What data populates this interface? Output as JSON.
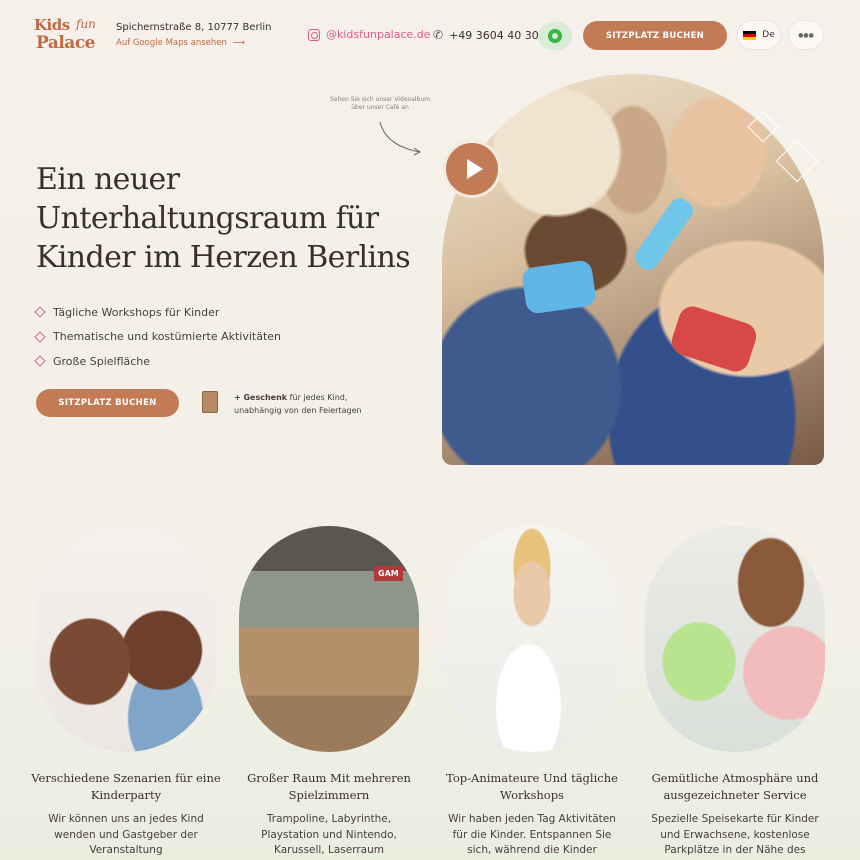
{
  "header": {
    "logo_line1": "Kids",
    "logo_line1b": "fun",
    "logo_line2": "Palace",
    "address": "Spichernstraße 8, 10777 Berlin",
    "maps_link": "Auf Google Maps ansehen",
    "instagram": "@kidsfunpalace.de",
    "phone": "+49 3604 40 30",
    "book_button": "SITZPLATZ BUCHEN",
    "language": "De",
    "menu_icon": "more-dots-icon"
  },
  "hero": {
    "annotation": "Sehen Sie sich unser Videoalbum über unser Café an",
    "title_lines": [
      "Ein neuer",
      "Unterhaltungsraum für",
      "Kinder im Herzen Berlins"
    ],
    "features": [
      "Tägliche Workshops für Kinder",
      "Thematische und kostümierte Aktivitäten",
      "Große Spielfläche"
    ],
    "book_button": "SITZPLATZ BUCHEN",
    "gift_bold": "+ Geschenk",
    "gift_rest": " für jedes Kind,",
    "gift_line2": "unabhängig von den Feiertagen"
  },
  "cards": [
    {
      "title": "Verschiedene Szenarien für eine Kinderparty",
      "text": "Wir können uns an jedes Kind wenden und Gastgeber der Veranstaltung"
    },
    {
      "title": "Großer Raum Mit mehreren Spielzimmern",
      "text": "Trampoline, Labyrinthe, Playstation und Nintendo, Karussell, Laserraum"
    },
    {
      "title": "Top-Animateure Und tägliche Workshops",
      "text": "Wir haben jeden Tag Aktivitäten für die Kinder. Entspannen Sie sich, während die Kinder"
    },
    {
      "title": "Gemütliche Atmosphäre und ausgezeichneter Service",
      "text": "Spezielle Speisekarte für Kinder und Erwachsene, kostenlose Parkplätze in der Nähe des"
    }
  ],
  "colors": {
    "accent": "#c27b54",
    "instagram": "#e05a86",
    "whatsapp": "#38b54a"
  }
}
